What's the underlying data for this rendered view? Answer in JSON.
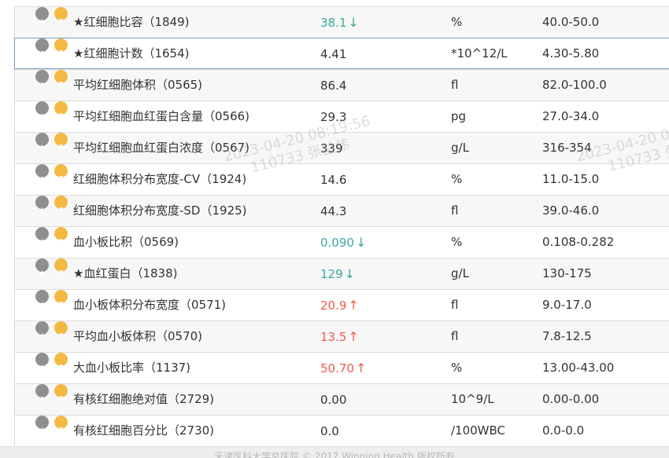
{
  "colors": {
    "low": "#3aa6a0",
    "high": "#ee5a4f",
    "star_icon": "#8f8f8f",
    "help_icon": "#f4b942"
  },
  "icons": {
    "star": "star-icon",
    "help": "question-icon",
    "low_flag": "arrow-down-icon",
    "high_flag": "arrow-up-icon"
  },
  "rows": [
    {
      "name": "★红细胞比容（1849)",
      "value": "38.1",
      "flag": "↓",
      "unit": "%",
      "ref": "40.0-50.0"
    },
    {
      "name": "★红细胞计数（1654)",
      "value": "4.41",
      "flag": "",
      "unit": "*10^12/L",
      "ref": "4.30-5.80"
    },
    {
      "name": "平均红细胞体积（0565)",
      "value": "86.4",
      "flag": "",
      "unit": "fl",
      "ref": "82.0-100.0"
    },
    {
      "name": "平均红细胞血红蛋白含量（0566)",
      "value": "29.3",
      "flag": "",
      "unit": "pg",
      "ref": "27.0-34.0"
    },
    {
      "name": "平均红细胞血红蛋白浓度（0567)",
      "value": "339",
      "flag": "",
      "unit": "g/L",
      "ref": "316-354"
    },
    {
      "name": "红细胞体积分布宽度-CV（1924)",
      "value": "14.6",
      "flag": "",
      "unit": "%",
      "ref": "11.0-15.0"
    },
    {
      "name": "红细胞体积分布宽度-SD（1925)",
      "value": "44.3",
      "flag": "",
      "unit": "fl",
      "ref": "39.0-46.0"
    },
    {
      "name": "血小板比积（0569)",
      "value": "0.090",
      "flag": "↓",
      "unit": "%",
      "ref": "0.108-0.282"
    },
    {
      "name": "★血红蛋白（1838)",
      "value": "129",
      "flag": "↓",
      "unit": "g/L",
      "ref": "130-175"
    },
    {
      "name": "血小板体积分布宽度（0571)",
      "value": "20.9",
      "flag": "↑",
      "unit": "fl",
      "ref": "9.0-17.0"
    },
    {
      "name": "平均血小板体积（0570)",
      "value": "13.5",
      "flag": "↑",
      "unit": "fl",
      "ref": "7.8-12.5"
    },
    {
      "name": "大血小板比率（1137)",
      "value": "50.70",
      "flag": "↑",
      "unit": "%",
      "ref": "13.00-43.00"
    },
    {
      "name": "有核红细胞绝对值（2729)",
      "value": "0.00",
      "flag": "",
      "unit": "10^9/L",
      "ref": "0.00-0.00"
    },
    {
      "name": "有核红细胞百分比（2730)",
      "value": "0.0",
      "flag": "",
      "unit": "/100WBC",
      "ref": "0.0-0.0"
    }
  ],
  "watermark": {
    "line1": "2023-04-20 08:19:56",
    "line2": "110733 张益伟",
    "line1_partial": "2023-04-20 0",
    "line2_partial": "110733 张"
  },
  "footer": {
    "text": "天津医科大学总医院    © 2017 Winning Health 版权所有"
  }
}
